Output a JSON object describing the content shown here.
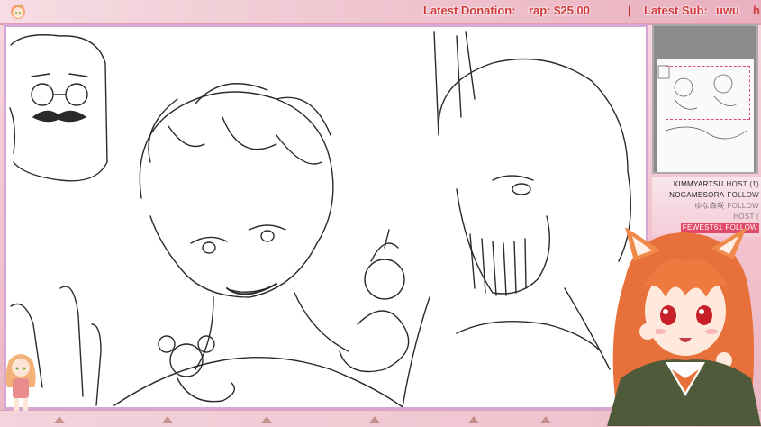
{
  "ticker": {
    "donation_label": "Latest Donation:",
    "donation_value": "rap: $25.00",
    "separator": "|",
    "sub_label": "Latest Sub:",
    "sub_value": "uwu",
    "overflow": "h"
  },
  "events": [
    {
      "name": "KIMMYARTSU",
      "type": "HOST (1)",
      "style": "normal"
    },
    {
      "name": "NOGAMESORA",
      "type": "FOLLOW",
      "style": "normal"
    },
    {
      "name": "ゆな森咲",
      "type": "FOLLOW",
      "style": "faded"
    },
    {
      "name": "",
      "type": "HOST (",
      "style": "faded"
    },
    {
      "name": "FEWEST61",
      "type": "FOLLOW",
      "style": "highlight"
    }
  ],
  "icons": {
    "ticker_chibi": "chibi-avatar-icon",
    "left_chibi": "chibi-girl-icon",
    "vtuber": "vtuber-avatar",
    "navigator": "navigator-preview"
  },
  "colors": {
    "ticker_text": "#d03a3a",
    "frame_border": "#d8a6d4",
    "event_highlight": "#e24a6a",
    "nav_viewport": "#e0458a"
  }
}
